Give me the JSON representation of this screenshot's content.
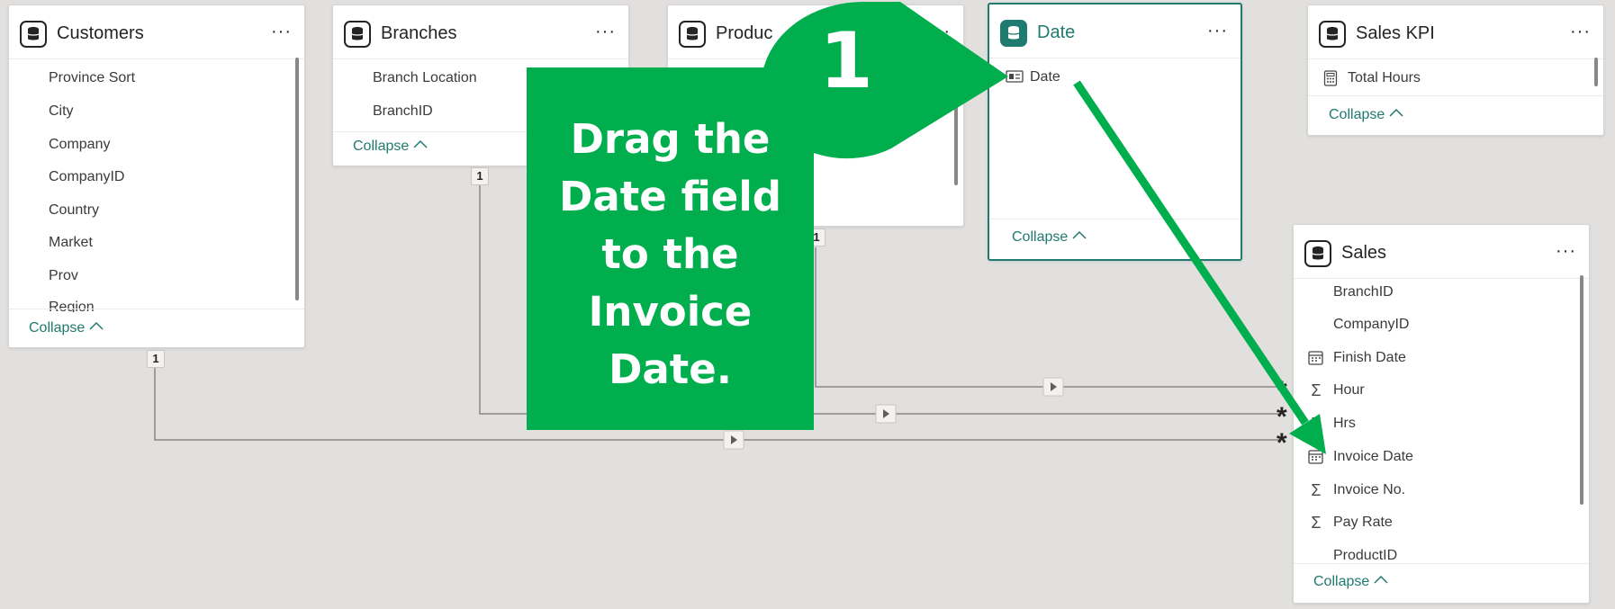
{
  "tables": {
    "customers": {
      "title": "Customers",
      "more": "···",
      "fields": [
        "Province Sort",
        "City",
        "Company",
        "CompanyID",
        "Country",
        "Market",
        "Prov",
        "Region"
      ],
      "collapse": "Collapse",
      "cardinality": "1"
    },
    "branches": {
      "title": "Branches",
      "more": "···",
      "fields": [
        "Branch Location",
        "BranchID"
      ],
      "collapse": "Collapse",
      "cardinality": "1"
    },
    "products": {
      "title": "Produc",
      "more": "···",
      "cardinality": "1"
    },
    "date": {
      "title": "Date",
      "more": "···",
      "fields": [
        {
          "name": "Date",
          "icon": "hierarchy-field-icon"
        }
      ],
      "collapse": "Collapse"
    },
    "sales_kpi": {
      "title": "Sales KPI",
      "more": "···",
      "fields": [
        {
          "name": "Total Hours",
          "icon": "calculator-icon"
        }
      ],
      "collapse": "Collapse"
    },
    "sales": {
      "title": "Sales",
      "more": "···",
      "fields": [
        {
          "name": "BranchID",
          "icon": ""
        },
        {
          "name": "CompanyID",
          "icon": ""
        },
        {
          "name": "Finish Date",
          "icon": "calendar-icon"
        },
        {
          "name": "Hour",
          "icon": "sigma-icon"
        },
        {
          "name": "Hrs",
          "icon": "sigma-icon"
        },
        {
          "name": "Invoice Date",
          "icon": "calendar-icon"
        },
        {
          "name": "Invoice No.",
          "icon": "sigma-icon"
        },
        {
          "name": "Pay Rate",
          "icon": "sigma-icon"
        },
        {
          "name": "ProductID",
          "icon": ""
        }
      ],
      "collapse": "Collapse",
      "many_marker": "*"
    }
  },
  "callout": {
    "step_number": "1",
    "lines": [
      "Drag the",
      "Date field",
      "to the",
      "Invoice",
      "Date."
    ]
  },
  "colors": {
    "canvas": "#e1e0df",
    "accent": "#1f7a6f",
    "callout_green": "#00ae4e"
  }
}
